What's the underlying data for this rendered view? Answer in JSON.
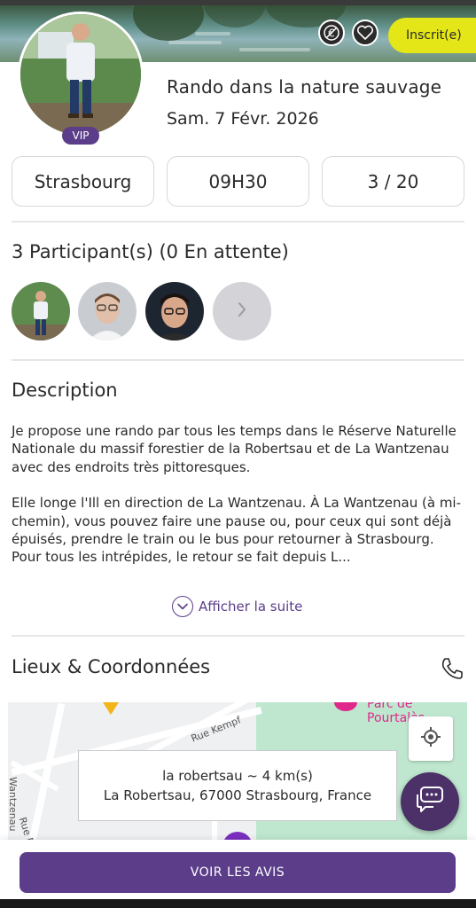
{
  "header": {
    "no_money_icon": "euro-strikethrough-icon",
    "favorite_icon": "heart-icon",
    "status_label": "Inscrit(e)",
    "status_color": "#e4e617"
  },
  "organizer": {
    "badge": "VIP",
    "badge_color": "#5b3d8a"
  },
  "event": {
    "title": "Rando dans la nature sauvage",
    "date": "Sam. 7 Févr. 2026",
    "city": "Strasbourg",
    "time": "09H30",
    "capacity": "3 / 20"
  },
  "participants": {
    "heading": "3 Participant(s) (0 En attente)",
    "more_icon": "chevron-right-icon"
  },
  "description": {
    "heading": "Description",
    "paragraph1": "Je propose une rando par tous les temps dans le Réserve Naturelle Nationale du massif forestier de la Robertsau et de La Wantzenau avec des endroits très pittoresques.",
    "paragraph2": "Elle longe l'Ill en direction de La Wantzenau. À La Wantzenau (à mi-chemin), vous pouvez faire une pause ou, pour ceux qui sont déjà épuisés, prendre le train ou le bus pour retourner à Strasbourg. Pour tous les intrépides, le retour se fait depuis L...",
    "show_more": "Afficher la suite"
  },
  "location": {
    "heading": "Lieux & Coordonnées",
    "phone_icon": "phone-icon",
    "map": {
      "street_1": "Rue Kempf",
      "street_2": "Rue Boecklin",
      "street_3": "Wantzenau",
      "park_label": "Parc de Pourtalès",
      "place_name": "la robertsau ~ 4 km(s)",
      "address": "La Robertsau, 67000 Strasbourg, France",
      "locate_icon": "crosshair-icon"
    }
  },
  "chat_icon": "chat-bubbles-icon",
  "footer": {
    "reviews_button": "VOIR LES AVIS",
    "accent_color": "#5b3d8a"
  }
}
